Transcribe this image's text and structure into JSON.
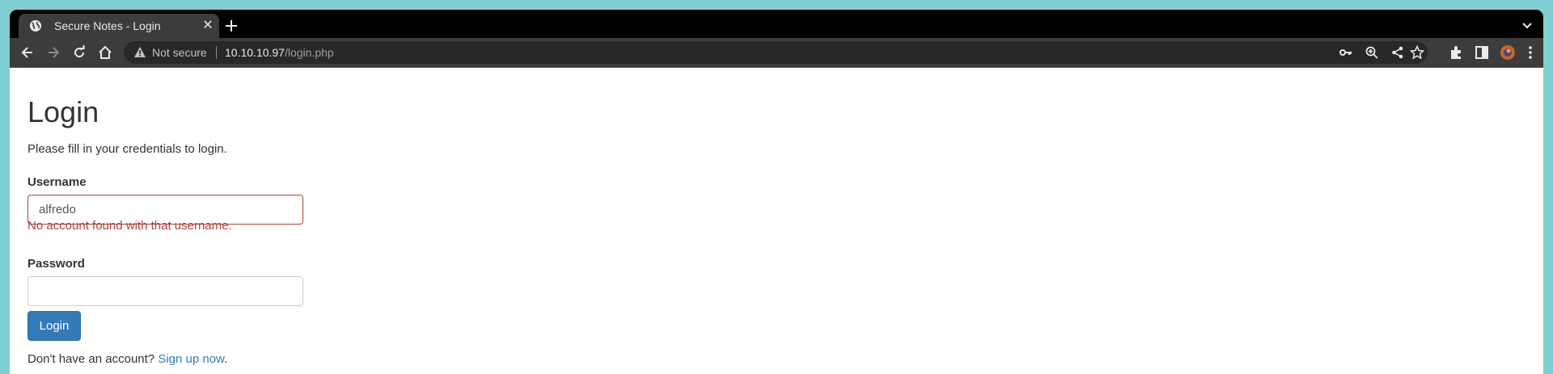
{
  "browser": {
    "tab": {
      "title": "Secure Notes - Login",
      "close_glyph": "✕"
    },
    "address_bar": {
      "security_label": "Not secure",
      "url_host": "10.10.10.97",
      "url_path": "/login.php"
    }
  },
  "page": {
    "heading": "Login",
    "intro": "Please fill in your credentials to login.",
    "username_label": "Username",
    "username_value": "alfredo",
    "username_error": "No account found with that username.",
    "password_label": "Password",
    "password_value": "",
    "login_button": "Login",
    "signup_prompt": "Don't have an account?",
    "signup_link": "Sign up now",
    "signup_suffix": "."
  },
  "colors": {
    "desktop": "#7fcfd3",
    "link": "#337ab7",
    "error": "#a94442",
    "button": "#337ab7"
  }
}
